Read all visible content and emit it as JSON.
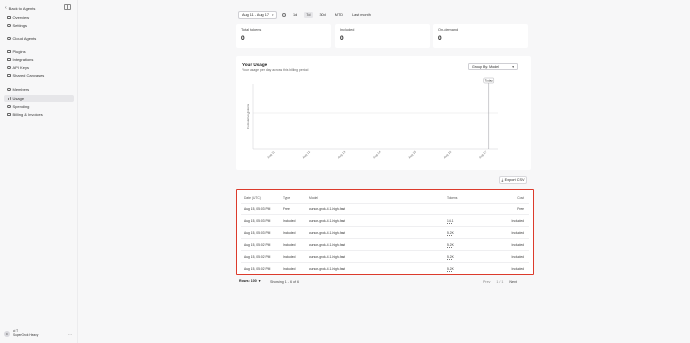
{
  "sidebar": {
    "back_label": "Back to Agents",
    "items": [
      {
        "label": "Overview",
        "icon": "home-icon"
      },
      {
        "label": "Settings",
        "icon": "gear-icon"
      },
      {
        "label": "Cloud Agents",
        "icon": "cloud-icon"
      },
      {
        "label": "Plugins",
        "icon": "plug-icon"
      },
      {
        "label": "Integrations",
        "icon": "grid-icon"
      },
      {
        "label": "API Keys",
        "icon": "key-icon"
      },
      {
        "label": "Shared Canvases",
        "icon": "canvas-icon"
      },
      {
        "label": "Members",
        "icon": "users-icon"
      },
      {
        "label": "Usage",
        "icon": "chart-icon"
      },
      {
        "label": "Spending",
        "icon": "dollar-icon"
      },
      {
        "label": "Billing & Invoices",
        "icon": "card-icon"
      }
    ],
    "active_item": "Usage",
    "user": {
      "initial": "C",
      "line1": "ci T",
      "line2": "SuperGrok Heavy"
    }
  },
  "toolbar": {
    "date_range": "Aug 11 - Aug 17",
    "ranges": [
      "1d",
      "7d",
      "30d",
      "MTD",
      "Last month"
    ],
    "active_range": "7d"
  },
  "stats": [
    {
      "label": "Total tokens",
      "value": "0"
    },
    {
      "label": "Included",
      "value": "0"
    },
    {
      "label": "On-demand",
      "value": "0"
    }
  ],
  "chart": {
    "title": "Your Usage",
    "subtitle": "Your usage per day across this billing period",
    "group_by": "Group By: Model",
    "ylabel": "Cumulative Tokens",
    "today_label": "Today",
    "zero_tick": "0"
  },
  "chart_data": {
    "type": "line",
    "x": [
      "Aug 11",
      "Aug 12",
      "Aug 13",
      "Aug 14",
      "Aug 15",
      "Aug 16",
      "Aug 17"
    ],
    "series": [],
    "ylabel": "Cumulative Tokens",
    "ytick": "0",
    "marker_label": "Today",
    "marker_x": "Aug 17",
    "grid": false
  },
  "export_label": "Export CSV",
  "table": {
    "headers": [
      "Date (UTC)",
      "Type",
      "Model",
      "Tokens",
      "Cost"
    ],
    "rows": [
      [
        "Aug 15, 05:03 PM",
        "Free",
        "cursor-grok-4.1-high-fast",
        "",
        "Free"
      ],
      [
        "Aug 15, 05:03 PM",
        "Included",
        "cursor-grok-4.1-high-fast",
        "14.1",
        "Included"
      ],
      [
        "Aug 15, 05:03 PM",
        "Included",
        "cursor-grok-4.1-high-fast",
        "5.2K",
        "Included"
      ],
      [
        "Aug 15, 05:02 PM",
        "Included",
        "cursor-grok-4.1-high-fast",
        "5.2K",
        "Included"
      ],
      [
        "Aug 15, 05:02 PM",
        "Included",
        "cursor-grok-4.1-high-fast",
        "5.2K",
        "Included"
      ],
      [
        "Aug 15, 05:02 PM",
        "Included",
        "cursor-grok-4.1-high-fast",
        "5.2K",
        "Included"
      ]
    ]
  },
  "footer": {
    "rows_label": "Rows: 100",
    "showing": "Showing 1 - 6 of 6",
    "prev": "Prev",
    "page": "1 / 1",
    "next": "Next"
  }
}
